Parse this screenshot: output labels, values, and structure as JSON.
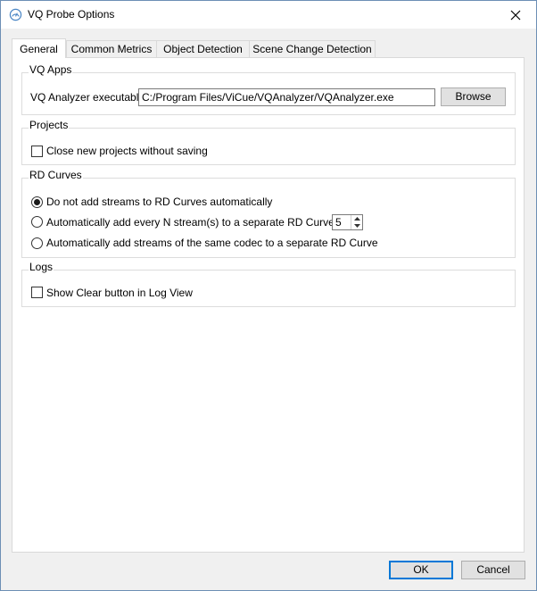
{
  "window": {
    "title": "VQ Probe Options"
  },
  "tabs": [
    "General",
    "Common Metrics",
    "Object Detection",
    "Scene Change Detection"
  ],
  "vq_apps": {
    "title": "VQ Apps",
    "analyzer_label": "VQ Analyzer executable",
    "analyzer_path": "C:/Program Files/ViCue/VQAnalyzer/VQAnalyzer.exe",
    "browse_label": "Browse"
  },
  "projects": {
    "title": "Projects",
    "close_without_saving_label": "Close new projects without saving"
  },
  "rd_curves": {
    "title": "RD Curves",
    "option_none": "Do not add streams to RD Curves automatically",
    "option_every_n": "Automatically add every N stream(s) to a separate RD Curve. N:",
    "n_value": "5",
    "option_same_codec": "Automatically add streams of the same codec to a separate RD Curve",
    "selected": "option_none"
  },
  "logs": {
    "title": "Logs",
    "show_clear_label": "Show Clear button in Log View"
  },
  "footer": {
    "ok_label": "OK",
    "cancel_label": "Cancel"
  },
  "colors": {
    "accent": "#0078d7",
    "icon": "#4a86c5"
  }
}
